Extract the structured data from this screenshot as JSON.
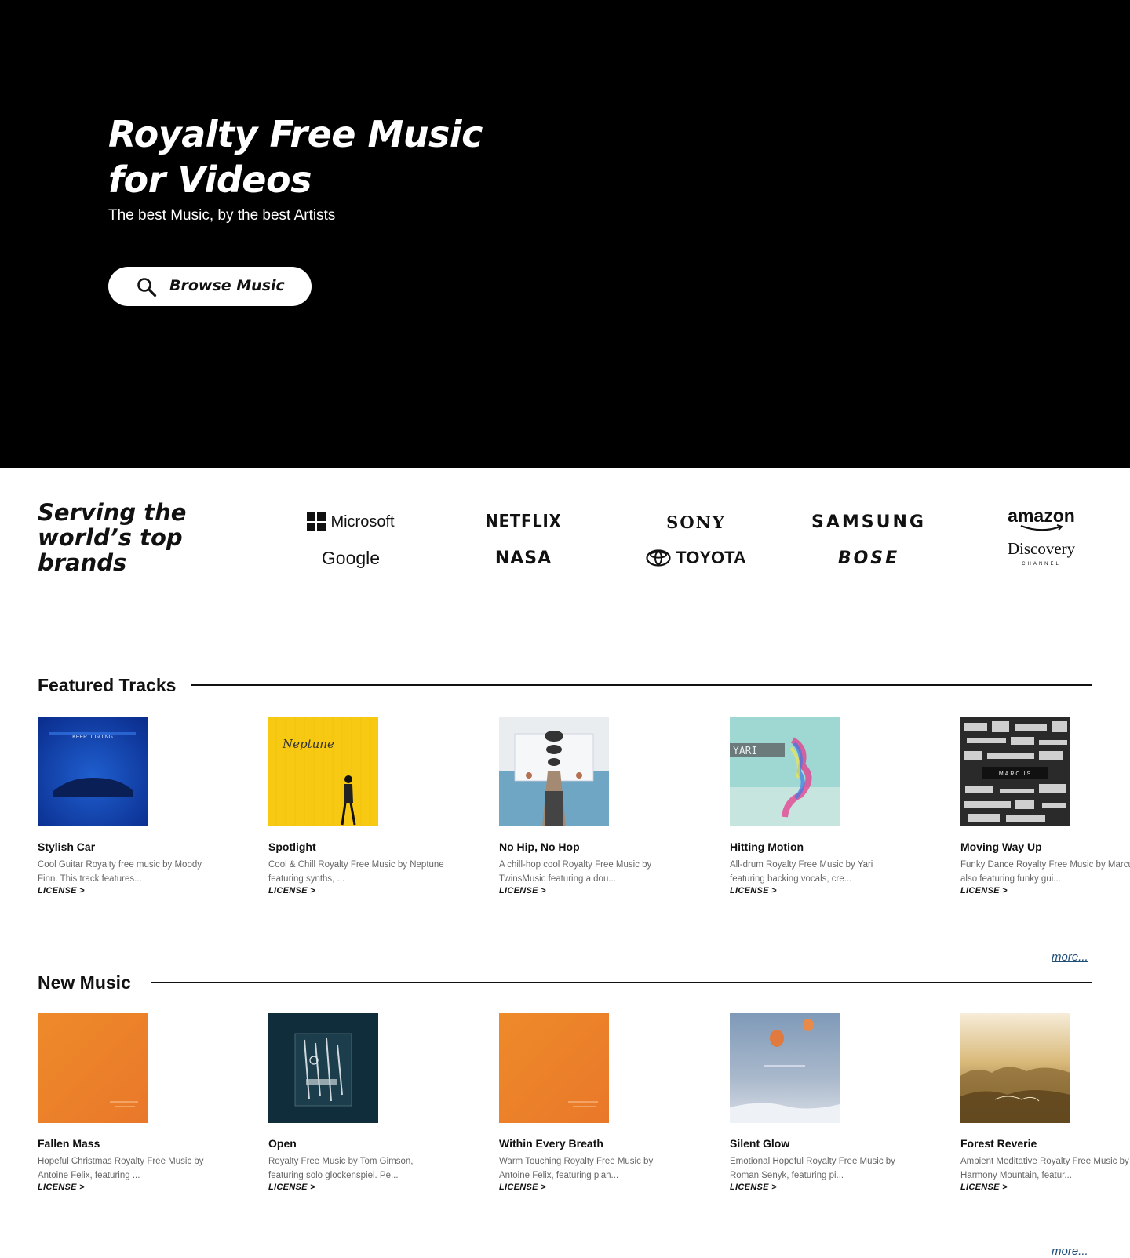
{
  "hero": {
    "title_line1": "Royalty Free Music",
    "title_line2": "for Videos",
    "subtitle": "The best Music, by the best Artists",
    "browse_label": "Browse Music",
    "icon": "search-icon"
  },
  "brands": {
    "title_line1": "Serving the",
    "title_line2": "world’s top",
    "title_line3": "brands",
    "logos": [
      "Microsoft",
      "NETFLIX",
      "SONY",
      "SAMSUNG",
      "amazon",
      "Google",
      "NASA",
      "TOYOTA",
      "BOSE",
      "Discovery",
      "CHANNEL"
    ]
  },
  "featured": {
    "title": "Featured Tracks",
    "more": "more...",
    "tracks": [
      {
        "name": "Stylish Car",
        "desc": "Cool Guitar Royalty free music by Moody Finn. This track features...",
        "license": "LICENSE >",
        "cover_text": "KEEP IT GOING"
      },
      {
        "name": "Spotlight",
        "desc": "Cool & Chill Royalty Free Music by Neptune featuring synths, ...",
        "license": "LICENSE >",
        "cover_text": "Neptune"
      },
      {
        "name": "No Hip, No Hop",
        "desc": "A chill-hop cool Royalty Free Music by TwinsMusic featuring a dou...",
        "license": "LICENSE >"
      },
      {
        "name": "Hitting Motion",
        "desc": "All-drum Royalty Free Music by Yari featuring backing vocals, cre...",
        "license": "LICENSE >",
        "cover_text": "YARI"
      },
      {
        "name": "Moving Way Up",
        "desc": "Funky Dance Royalty Free Music by Marcus also featuring funky gui...",
        "license": "LICENSE >",
        "cover_text": "MARCUS"
      }
    ]
  },
  "new_music": {
    "title": "New Music",
    "more": "more...",
    "tracks": [
      {
        "name": "Fallen Mass",
        "desc": "Hopeful Christmas Royalty Free Music by Antoine Felix, featuring ...",
        "license": "LICENSE >"
      },
      {
        "name": "Open",
        "desc": "Royalty Free Music by Tom Gimson, featuring solo glockenspiel. Pe...",
        "license": "LICENSE >"
      },
      {
        "name": "Within Every Breath",
        "desc": "Warm Touching Royalty Free Music by Antoine Felix, featuring pian...",
        "license": "LICENSE >"
      },
      {
        "name": "Silent Glow",
        "desc": "Emotional Hopeful Royalty Free Music by Roman Senyk, featuring pi...",
        "license": "LICENSE >"
      },
      {
        "name": "Forest Reverie",
        "desc": "Ambient Meditative Royalty Free Music by Harmony Mountain, featur...",
        "license": "LICENSE >"
      }
    ]
  },
  "colors": {
    "hero_bg": "#000000",
    "text": "#111111",
    "muted": "#666666",
    "link": "#1f4e79"
  }
}
